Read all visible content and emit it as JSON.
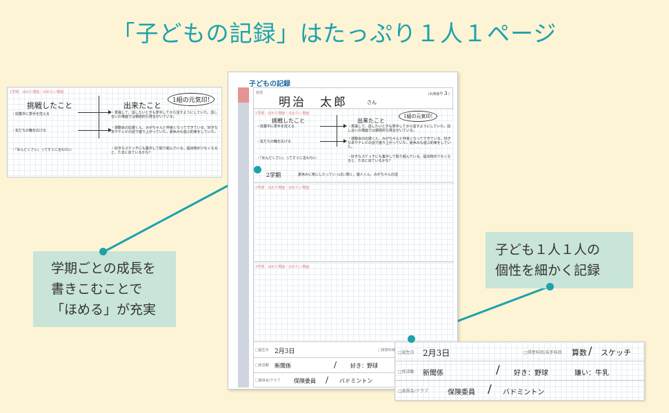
{
  "headline": "「子どもの記録」はたっぷり１人１ページ",
  "page": {
    "title": "子どもの記録",
    "name_label": "名前",
    "student_name": "明治　太郎",
    "name_suffix": "さん",
    "number_label": "(出席番号",
    "number_value": "3",
    "number_close": ")"
  },
  "term1": {
    "header": "1学期　ほめた場面・ほめたい場面",
    "tag": "1学期",
    "header_short": "ほめた場面・ほめたい場面",
    "challenge_title": "挑戦したこと",
    "done_title": "出来たこと",
    "badge": "1組の元気印!",
    "challenges": [
      "・授業中に挙手を控える",
      "・友だちの輪を広げる",
      "・「めんどくさい」ってすぐに言わない"
    ],
    "achievements": [
      "・意識して、話したいときも挙手してから話すようにしていた。話し合いの場面では積極的な発言がいている。",
      "・運動会の応援くん、みがちゃんと仲良くなってできている。好きな本やテレビの話で盛り上がっていた。夏休みも遊ぶ約束をしていた。",
      "・好きなスケッチにも集中して取り組んでいる。提出物が少なくなると、たまに出ているかな?"
    ],
    "term2_line_label": "2学期",
    "term2_line_text": "夏休みに気にしたっていっぱい聞く。諸人くん、みがちゃんの話"
  },
  "term2": {
    "header": "2学期　ほめた場面・ほめたい場面"
  },
  "term3": {
    "header": "3学期　ほめた場面・ほめたい場面"
  },
  "footer": {
    "birthday_label": "□誕生日",
    "birthday": "2月3日",
    "subjects_label": "□得意科目/苦手科目",
    "subject_good": "算数",
    "subject_bad": "スケッチ",
    "committee_label": "□係活動",
    "committee": "新聞係",
    "likes": "好き：野球",
    "dislikes": "嫌い：牛乳",
    "club_label": "□委員会/クラブ",
    "club_committee": "保険委員",
    "club": "バドミントン",
    "slash": "/"
  },
  "callouts": {
    "left": [
      "学期ごとの成長を",
      "書きこむことで",
      "「ほめる」が充実"
    ],
    "right": [
      "子ども１人１人の",
      "個性を細かく記録"
    ]
  },
  "colors": {
    "accent": "#1ba2ad",
    "callout_bg": "#c9e4d8",
    "background": "#fdf3d5",
    "pink": "#e27f82"
  }
}
